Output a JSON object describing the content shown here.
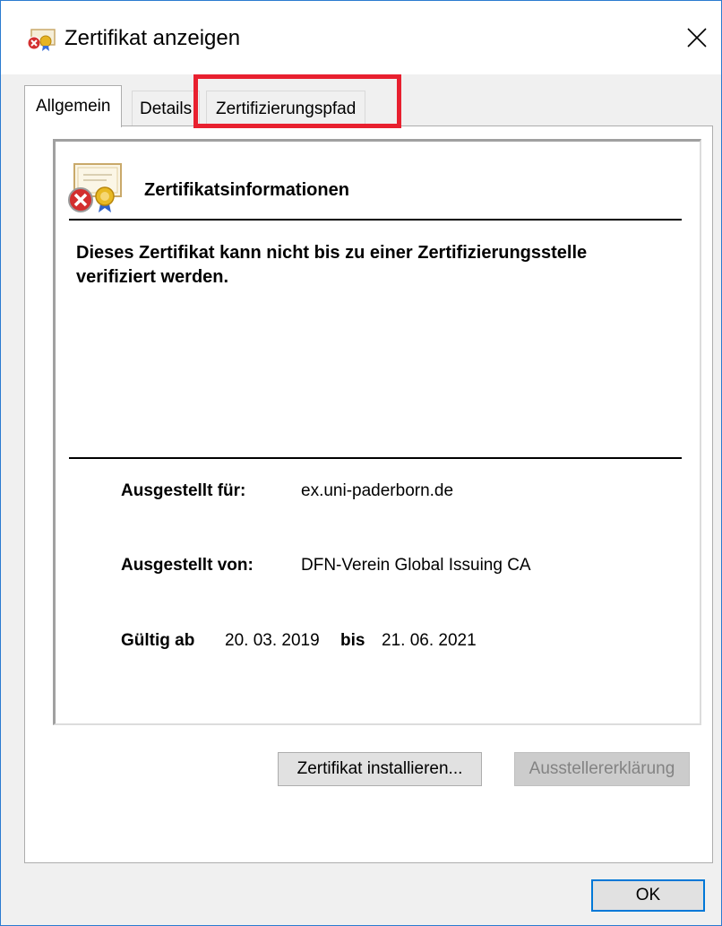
{
  "window": {
    "title": "Zertifikat anzeigen",
    "close_glyph": "✕"
  },
  "tabs": [
    {
      "label": "Allgemein",
      "selected": true
    },
    {
      "label": "Details",
      "selected": false
    },
    {
      "label": "Zertifizierungspfad",
      "selected": false,
      "highlighted": true
    }
  ],
  "info": {
    "heading": "Zertifikatsinformationen",
    "warning": "Dieses Zertifikat kann nicht bis zu einer Zertifizierungsstelle verifiziert werden."
  },
  "fields": {
    "issued_to_label": "Ausgestellt für:",
    "issued_to_value": "ex.uni-paderborn.de",
    "issued_by_label": "Ausgestellt von:",
    "issued_by_value": "DFN-Verein Global Issuing CA",
    "valid_from_label": "Gültig ab",
    "valid_from_value": "20. 03. 2019",
    "valid_to_label": "bis",
    "valid_to_value": "21. 06. 2021"
  },
  "buttons": {
    "install": "Zertifikat installieren...",
    "issuer_statement": "Ausstellererklärung",
    "ok": "OK"
  },
  "colors": {
    "highlight": "#e8202f",
    "window_border": "#2b7bd0",
    "ok_focus": "#0078d7",
    "disabled_text": "#838383"
  },
  "icons": {
    "title": "certificate-error-icon",
    "cert": "certificate-error-icon",
    "close": "close-icon"
  }
}
